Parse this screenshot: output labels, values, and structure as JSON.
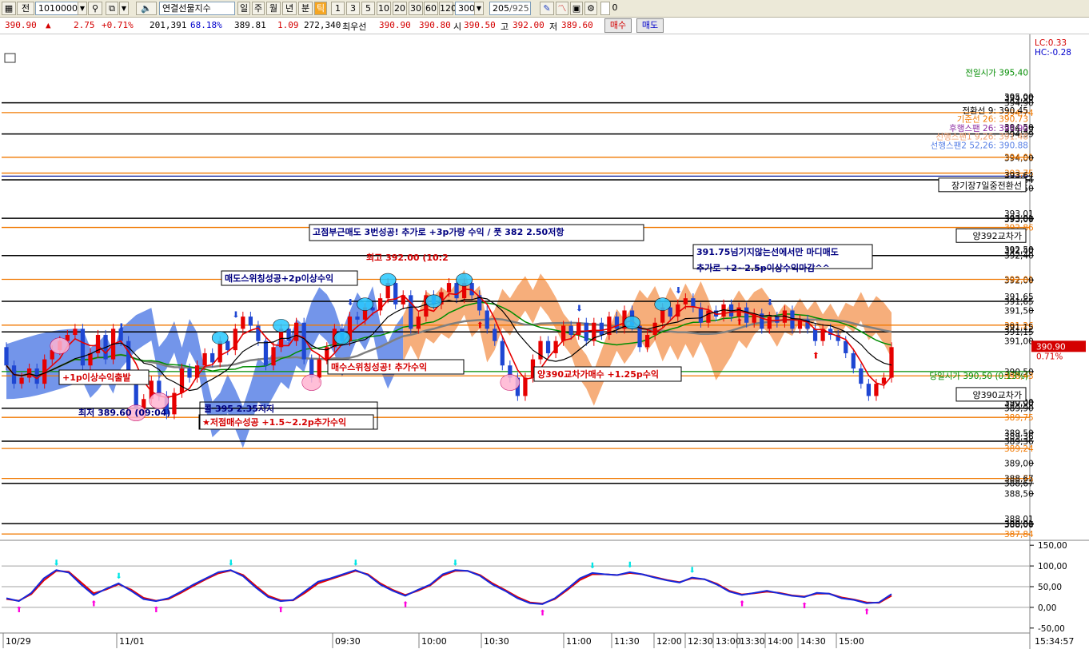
{
  "toolbar": {
    "mode_label": "전",
    "code": "10100000",
    "instrument": "연결선물지수",
    "periods": [
      "일",
      "주",
      "월",
      "년",
      "분",
      "틱"
    ],
    "active_period": "틱",
    "intervals": [
      "1",
      "3",
      "5",
      "10",
      "20",
      "30",
      "60",
      "120"
    ],
    "tick_value": "300",
    "counter": "205",
    "counter_total": "/925",
    "checkbox_label": "0"
  },
  "quote": {
    "price": "390.90",
    "arrow": "▲",
    "change": "2.75",
    "change_pct": "+0.71%",
    "volume": "201,391",
    "volume_pct": "68.18%",
    "theory": "389.81",
    "basis": "1.09",
    "open_interest": "272,340",
    "best_label": "최우선",
    "best_ask": "390.90",
    "best_bid": "390.80",
    "open_label": "시",
    "open": "390.50",
    "high_label": "고",
    "high": "392.00",
    "low_label": "저",
    "low": "389.60",
    "buy_label": "매수",
    "sell_label": "매도"
  },
  "colors": {
    "bull": "#e60000",
    "bear": "#1e46d2",
    "cloud_bear": "#5a82e6",
    "cloud_bull": "#f5a064",
    "orange_line": "#f07800",
    "navy_line": "#0a1ea0",
    "green_line": "#008c00",
    "stoch_k": "#1428dc",
    "stoch_d": "#e60000",
    "cyan_marker": "#00e6e6",
    "magenta_marker": "#ff00dc"
  },
  "chart_data": {
    "type": "candlestick",
    "title": "",
    "price_axis": {
      "ylim": [
        387.75,
        395.55
      ],
      "ticks": [
        "395,00",
        "394,90",
        "394,50",
        "394,39",
        "394,00",
        "393,64",
        "393,50",
        "393,01",
        "393,00",
        "392,50",
        "392,40",
        "392,00",
        "391,65",
        "391,50",
        "391,15",
        "391,00",
        "390,50",
        "390,00",
        "389,90",
        "389,50",
        "389,36",
        "389,00",
        "388,67",
        "388,50",
        "388,01",
        "388,00"
      ]
    },
    "oscillator_axis": {
      "ylim": [
        -60,
        160
      ],
      "ticks": [
        "150,00",
        "100,00",
        "50,00",
        "0,00",
        "-50,00"
      ]
    },
    "time_labels": [
      "10/29",
      "11/01",
      "09:30",
      "10:00",
      "10:30",
      "11:00",
      "11:30",
      "12:00",
      "12:30",
      "13:00",
      "13:30",
      "14:00",
      "14:30",
      "15:00"
    ],
    "clock": "15:34:57",
    "corner_labels": {
      "lc": "LC:0.33",
      "hc": "HC:-0.28"
    },
    "price_tag": {
      "price": "390.90",
      "pct": "0.71%"
    },
    "price_labels": {
      "orange": [
        "394,74",
        "394,01",
        "393,75",
        "392,86",
        "392,01",
        "391,26",
        "390,43",
        "389,75",
        "389,24",
        "388,75",
        "387,84"
      ],
      "black": [
        "394,90",
        "394,39",
        "393,64",
        "393,01",
        "392,40",
        "391,65",
        "391,15",
        "389,90",
        "389,36",
        "388,67",
        "388,01"
      ]
    },
    "horizontal_lines": [
      {
        "value": 394.9,
        "kind": "black"
      },
      {
        "value": 394.74,
        "kind": "orange"
      },
      {
        "value": 394.39,
        "kind": "black"
      },
      {
        "value": 394.01,
        "kind": "orange"
      },
      {
        "value": 393.75,
        "kind": "orange"
      },
      {
        "value": 393.7,
        "kind": "navy"
      },
      {
        "value": 393.64,
        "kind": "black"
      },
      {
        "value": 393.01,
        "kind": "black"
      },
      {
        "value": 392.86,
        "kind": "orange"
      },
      {
        "value": 392.4,
        "kind": "black"
      },
      {
        "value": 392.01,
        "kind": "orange"
      },
      {
        "value": 391.65,
        "kind": "black"
      },
      {
        "value": 391.26,
        "kind": "orange"
      },
      {
        "value": 391.15,
        "kind": "black"
      },
      {
        "value": 390.5,
        "kind": "green"
      },
      {
        "value": 390.43,
        "kind": "orange"
      },
      {
        "value": 389.9,
        "kind": "black"
      },
      {
        "value": 389.75,
        "kind": "orange"
      },
      {
        "value": 389.36,
        "kind": "black"
      },
      {
        "value": 389.24,
        "kind": "orange"
      },
      {
        "value": 388.75,
        "kind": "orange"
      },
      {
        "value": 388.67,
        "kind": "black"
      },
      {
        "value": 388.01,
        "kind": "black"
      },
      {
        "value": 387.84,
        "kind": "orange"
      }
    ],
    "indicator_labels": [
      {
        "text": "전일시가 395,40",
        "value": 395.4,
        "color": "#008c00"
      },
      {
        "text": "전환선 9: 390.45",
        "value": 394.78,
        "color": "#000000"
      },
      {
        "text": "기준선 26: 390.73",
        "value": 394.64,
        "color": "#f07800"
      },
      {
        "text": "후행스팬 26: 390.90",
        "value": 394.49,
        "color": "#8b2aa0"
      },
      {
        "text": "선행스팬1 9,26: 391.48",
        "value": 394.35,
        "color": "#f0a070"
      },
      {
        "text": "선행스팬2 52,26: 390.88",
        "value": 394.21,
        "color": "#5a82e6"
      },
      {
        "text": "당일시가 390,50 (0.13%)",
        "value": 390.43,
        "color": "#008c00"
      }
    ],
    "boxed_labels": [
      {
        "text": "장기장7일중전환선",
        "value": 393.55
      },
      {
        "text": "양392교차가",
        "value": 392.72
      },
      {
        "text": "양390교차가",
        "value": 390.12
      }
    ],
    "series": [
      {
        "name": "candles",
        "open": [
          390.9,
          390.6,
          390.3,
          390.4,
          390.55,
          390.3,
          390.7,
          390.85,
          391.0,
          391.1,
          391.2,
          390.6,
          390.8,
          391.1,
          390.7,
          391.2,
          391.0,
          390.4,
          389.9,
          390.05,
          390.35,
          390.1,
          389.8,
          390.15,
          390.55,
          390.4,
          390.6,
          390.8,
          390.65,
          391.0,
          390.85,
          391.2,
          391.4,
          391.25,
          391.0,
          390.6,
          390.9,
          391.2,
          391.0,
          391.3,
          390.7,
          390.4,
          390.7,
          390.9,
          391.2,
          391.0,
          391.4,
          391.35,
          391.55,
          391.5,
          391.7,
          391.95,
          391.6,
          391.75,
          391.2,
          391.4,
          391.75,
          391.6,
          391.8,
          391.95,
          391.7,
          391.95,
          391.75,
          391.5,
          391.2,
          391.0,
          390.6,
          390.4,
          390.1,
          390.4,
          390.7,
          391.0,
          390.8,
          391.0,
          391.25,
          391.1,
          391.3,
          391.0,
          391.3,
          391.1,
          391.4,
          391.2,
          391.5,
          391.25,
          390.9,
          391.1,
          391.3,
          391.55,
          391.4,
          391.6,
          391.7,
          391.55,
          391.3,
          391.5,
          391.4,
          391.6,
          391.4,
          391.55,
          391.3,
          391.45,
          391.2,
          391.4,
          391.3,
          391.5,
          391.2,
          391.35,
          391.2,
          391.0,
          391.2,
          391.1,
          391.0,
          390.8,
          390.55,
          390.3,
          390.1,
          390.3,
          390.4
        ],
        "close": [
          390.6,
          390.3,
          390.4,
          390.55,
          390.3,
          390.7,
          390.85,
          391.0,
          391.1,
          391.2,
          390.6,
          390.8,
          391.1,
          390.7,
          391.2,
          391.0,
          390.4,
          389.9,
          390.05,
          390.35,
          390.1,
          389.8,
          390.15,
          390.55,
          390.4,
          390.6,
          390.8,
          390.65,
          391.0,
          390.85,
          391.2,
          391.4,
          391.25,
          391.0,
          390.6,
          390.9,
          391.2,
          391.0,
          391.3,
          390.7,
          390.4,
          390.7,
          390.9,
          391.2,
          391.0,
          391.4,
          391.35,
          391.55,
          391.5,
          391.7,
          391.95,
          391.6,
          391.75,
          391.2,
          391.4,
          391.75,
          391.6,
          391.8,
          391.95,
          391.7,
          391.95,
          391.75,
          391.5,
          391.2,
          391.0,
          390.6,
          390.4,
          390.1,
          390.4,
          390.7,
          391.0,
          390.8,
          391.0,
          391.25,
          391.1,
          391.3,
          391.0,
          391.3,
          391.1,
          391.4,
          391.2,
          391.5,
          391.25,
          390.9,
          391.1,
          391.3,
          391.55,
          391.4,
          391.6,
          391.7,
          391.55,
          391.3,
          391.5,
          391.4,
          391.6,
          391.4,
          391.55,
          391.3,
          391.45,
          391.2,
          391.4,
          391.3,
          391.5,
          391.2,
          391.35,
          391.2,
          391.0,
          391.2,
          391.1,
          391.0,
          390.8,
          390.55,
          390.3,
          390.1,
          390.3,
          390.4,
          390.9
        ]
      }
    ],
    "annotations": [
      {
        "text": "고점부근매도 3번성공! 추가로 +3p가량 수익 / 풋 382 2.50저항",
        "color": "#000080"
      },
      {
        "text": "최고 392.00 (10:2",
        "color": "#d40000"
      },
      {
        "text": "391.75넘기지않는선에서만 마디매도",
        "color": "#000080"
      },
      {
        "text": "추가로 +2~2.5p이상수익마감^^",
        "color": "#000080"
      },
      {
        "text": "매도스위칭성공+2p이상수익",
        "color": "#000080"
      },
      {
        "text": "매수스위칭성공! 추가수익",
        "color": "#d40000"
      },
      {
        "text": "양390교차가매수 +1.25p수익",
        "color": "#d40000"
      },
      {
        "text": "+1p이상수익출발",
        "color": "#d40000"
      },
      {
        "text": "최저 389.60 (09:04)",
        "color": "#000080"
      },
      {
        "text": "콜 395 2.35지지",
        "color": "#000080"
      },
      {
        "text": "★저점매수성공 +1.5~2.2p추가수익",
        "color": "#d40000"
      }
    ],
    "oscillator": {
      "name": "",
      "k": [
        22,
        15,
        35,
        70,
        90,
        84,
        55,
        30,
        45,
        58,
        40,
        20,
        15,
        22,
        38,
        55,
        70,
        85,
        90,
        75,
        48,
        25,
        15,
        18,
        40,
        62,
        70,
        80,
        90,
        78,
        55,
        40,
        28,
        42,
        55,
        80,
        90,
        88,
        76,
        55,
        40,
        22,
        10,
        8,
        22,
        45,
        70,
        83,
        80,
        78,
        85,
        80,
        72,
        65,
        60,
        72,
        68,
        55,
        38,
        30,
        35,
        40,
        34,
        28,
        25,
        35,
        33,
        22,
        18,
        10,
        12,
        32
      ],
      "d": [
        20,
        16,
        32,
        65,
        88,
        86,
        60,
        34,
        43,
        56,
        43,
        23,
        16,
        20,
        35,
        52,
        68,
        82,
        89,
        78,
        52,
        28,
        17,
        17,
        36,
        58,
        68,
        78,
        88,
        80,
        58,
        42,
        30,
        40,
        53,
        77,
        88,
        88,
        78,
        58,
        42,
        25,
        12,
        9,
        20,
        42,
        66,
        80,
        80,
        78,
        83,
        80,
        73,
        66,
        61,
        70,
        68,
        57,
        40,
        31,
        34,
        38,
        35,
        29,
        26,
        33,
        33,
        24,
        19,
        12,
        11,
        28
      ]
    }
  }
}
